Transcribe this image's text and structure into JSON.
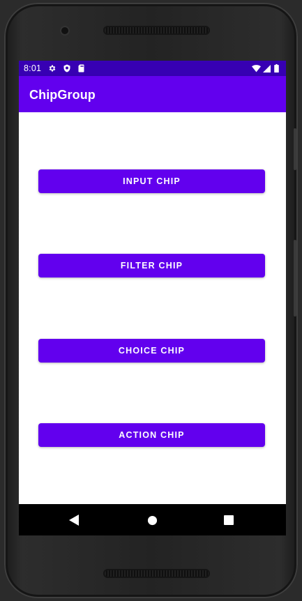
{
  "status_bar": {
    "time": "8:01",
    "left_icons": [
      "gear-icon",
      "shield-icon",
      "sd-card-icon"
    ],
    "right_icons": [
      "wifi-icon",
      "cell-signal-icon",
      "battery-icon"
    ]
  },
  "app_bar": {
    "title": "ChipGroup"
  },
  "buttons": [
    {
      "label": "INPUT CHIP"
    },
    {
      "label": "FILTER CHIP"
    },
    {
      "label": "CHOICE CHIP"
    },
    {
      "label": "ACTION CHIP"
    }
  ],
  "nav_bar": {
    "icons": [
      "back-icon",
      "home-icon",
      "recents-icon"
    ]
  },
  "colors": {
    "status_bar": "#3700b3",
    "primary": "#6200ee",
    "on_primary": "#ffffff",
    "background": "#ffffff",
    "nav_bar": "#000000"
  }
}
